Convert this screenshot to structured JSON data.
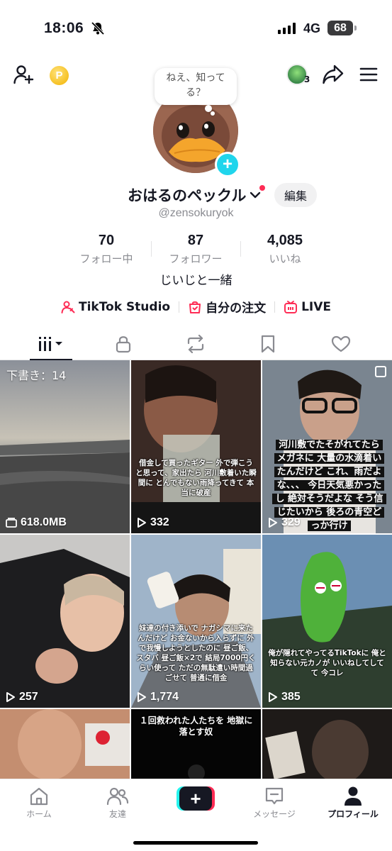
{
  "status_bar": {
    "time": "18:06",
    "network": "4G",
    "battery": "68"
  },
  "profile": {
    "bubble_text": "ねえ、知ってる？",
    "display_name": "おはるのペックル",
    "edit_label": "編集",
    "username": "@zensokuryok",
    "stats": [
      {
        "value": "70",
        "label": "フォロー中"
      },
      {
        "value": "87",
        "label": "フォロワー"
      },
      {
        "value": "4,085",
        "label": "いいね"
      }
    ],
    "bio": "じいじと一緒",
    "friend_count": "3",
    "links": {
      "studio": "TikTok Studio",
      "orders": "自分の注文",
      "live": "LIVE"
    }
  },
  "grid": {
    "videos": [
      {
        "top_label": "下書き：14",
        "views": "618.0MB"
      },
      {
        "caption": "借金して買ったギター 外で弾こうと思って、家出たら 河川敷着いた瞬間に とんでもない雨降ってきて 本当に破産",
        "views": "332"
      },
      {
        "caption": "河川敷でたそがれてたら メガネに 大量の水滴着いたんだけど これ、雨だよな、、、 今日天気悪かったし 絶対そうだよな そう信じたいから 後ろの青空どっか行け",
        "views": "329"
      },
      {
        "views": "257"
      },
      {
        "caption": "妹達の付き添いで ナガシマに来たんだけど お金ないから入らずに 外で我慢しようとしたのに 昼ご飯、スタバ 昼ご飯×2で 結局7000円くらい使って ただの無駄遣い時間過ごせて 普通に借金",
        "views": "1,774"
      },
      {
        "caption": "俺が隠れてやってるTikTokに 俺と知らない元カノが いいねしてしてて 今コレ",
        "views": "385"
      },
      {},
      {
        "caption": "１回救われた人たちを 地獄に落とす奴"
      },
      {}
    ]
  },
  "nav": {
    "home": "ホーム",
    "friends": "友達",
    "messages": "メッセージ",
    "profile": "プロフィール"
  }
}
